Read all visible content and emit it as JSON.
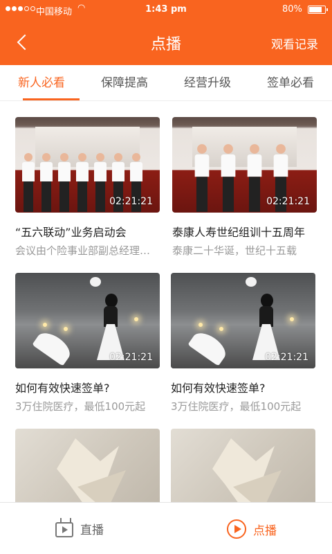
{
  "status_bar": {
    "carrier": "中国移动",
    "time": "1:43 pm",
    "battery": "80%"
  },
  "nav": {
    "title": "点播",
    "right_link": "观看记录"
  },
  "tabs": [
    {
      "label": "新人必看",
      "active": true
    },
    {
      "label": "保障提高",
      "active": false
    },
    {
      "label": "经营升级",
      "active": false
    },
    {
      "label": "签单必看",
      "active": false
    }
  ],
  "videos": [
    {
      "title": "“五六联动”业务启动会",
      "desc": "会议由个险事业部副总经理主持",
      "duration": "02:21:21",
      "thumb": "stage"
    },
    {
      "title": "泰康人寿世纪组训十五周年",
      "desc": "泰康二十华诞，世纪十五载",
      "duration": "02:21:21",
      "thumb": "stage"
    },
    {
      "title": "如何有效快速签单?",
      "desc": "3万住院医疗，最低100元起",
      "duration": "02:21:21",
      "thumb": "rain"
    },
    {
      "title": "如何有效快速签单?",
      "desc": "3万住院医疗，最低100元起",
      "duration": "02:21:21",
      "thumb": "rain"
    },
    {
      "title": "",
      "desc": "",
      "duration": "",
      "thumb": "crane"
    },
    {
      "title": "",
      "desc": "",
      "duration": "",
      "thumb": "crane"
    }
  ],
  "bottom_tabs": [
    {
      "label": "直播",
      "icon": "tv-icon",
      "active": false
    },
    {
      "label": "点播",
      "icon": "play-circle-icon",
      "active": true
    }
  ],
  "colors": {
    "accent": "#f9641f"
  }
}
